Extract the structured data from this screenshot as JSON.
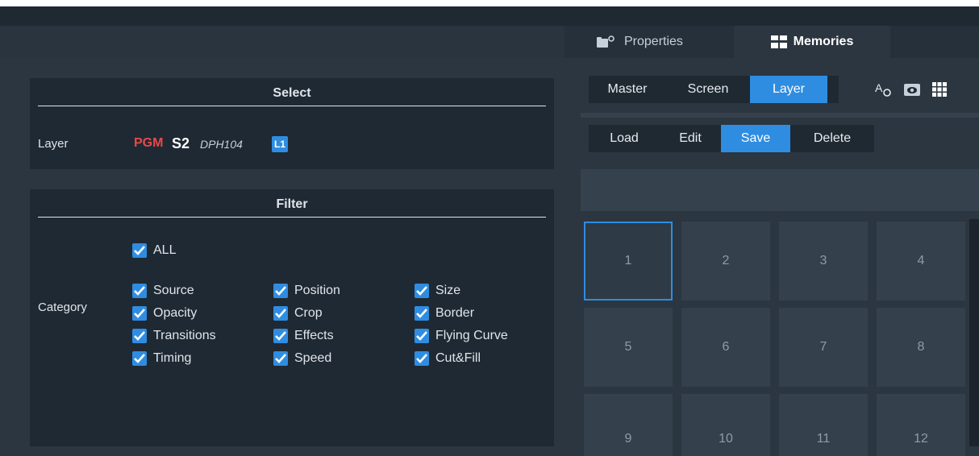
{
  "tabs": {
    "properties": {
      "label": "Properties",
      "icon": "folder-gear-icon"
    },
    "memories": {
      "label": "Memories",
      "icon": "grid-layout-icon"
    }
  },
  "select": {
    "title": "Select",
    "layer_label": "Layer",
    "pgm": "PGM",
    "screen": "S2",
    "device": "DPH104",
    "layer_badge": "L1"
  },
  "filter": {
    "title": "Filter",
    "category_label": "Category",
    "all": "ALL",
    "items": [
      "Source",
      "Position",
      "Size",
      "Opacity",
      "Crop",
      "Border",
      "Transitions",
      "Effects",
      "Flying Curve",
      "Timing",
      "Speed",
      "Cut&Fill"
    ]
  },
  "mode_bar": {
    "buttons": [
      "Master",
      "Screen",
      "Layer"
    ],
    "active": "Layer",
    "icons": [
      "rename-icon",
      "preview-eye-icon",
      "grid-view-icon"
    ]
  },
  "action_bar": {
    "buttons": [
      "Load",
      "Edit",
      "Save",
      "Delete"
    ],
    "active": "Save"
  },
  "memory_grid": {
    "cells": [
      "1",
      "2",
      "3",
      "4",
      "5",
      "6",
      "7",
      "8",
      "9",
      "10",
      "11",
      "12"
    ],
    "selected": "1"
  },
  "colors": {
    "accent": "#2f8de1",
    "pgm": "#e64a4a",
    "panel": "#1f2933",
    "background": "#2b3640"
  }
}
